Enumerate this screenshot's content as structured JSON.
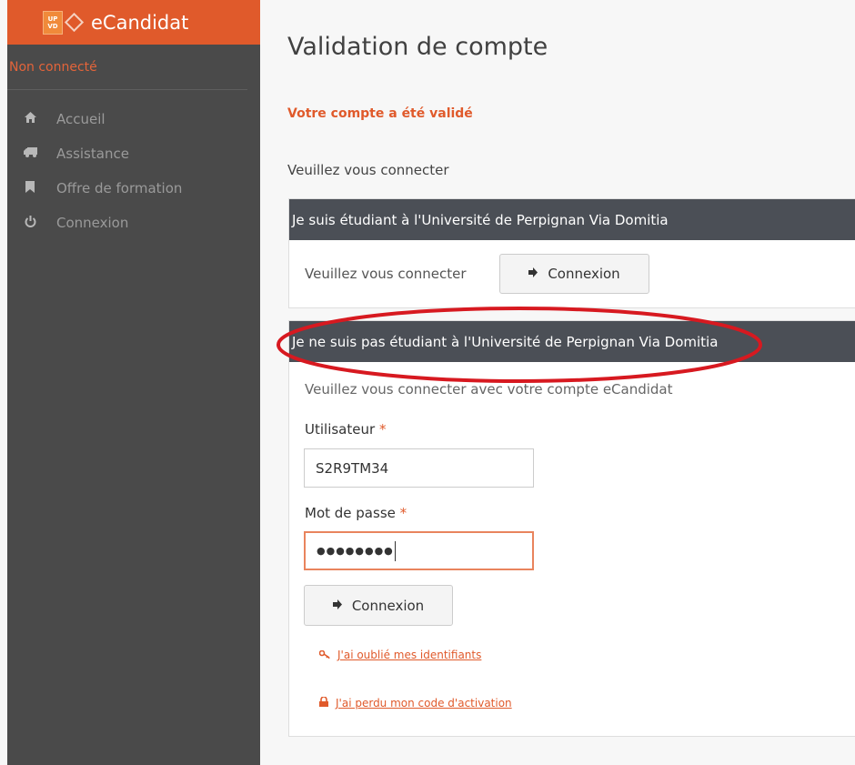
{
  "sidebar": {
    "brand": {
      "logo_line1": "UP",
      "logo_line2": "VD",
      "name": "eCandidat"
    },
    "status": "Non connecté",
    "items": [
      {
        "label": "Accueil",
        "icon": "home-icon"
      },
      {
        "label": "Assistance",
        "icon": "truck-icon"
      },
      {
        "label": "Offre de formation",
        "icon": "bookmark-icon"
      },
      {
        "label": "Connexion",
        "icon": "power-icon"
      }
    ]
  },
  "main": {
    "title": "Validation de compte",
    "success_message": "Votre compte a été validé",
    "intro": "Veuillez vous connecter",
    "panel_student": {
      "heading": "Je suis étudiant à l'Université de Perpignan Via Domitia",
      "text": "Veuillez vous connecter",
      "button_label": "Connexion",
      "button_icon": "sign-in-icon"
    },
    "panel_external": {
      "heading": "Je ne suis pas étudiant à l'Université de Perpignan Via Domitia",
      "lead": "Veuillez vous connecter avec votre compte eCandidat",
      "user_label": "Utilisateur",
      "user_value": "S2R9TM34",
      "password_label": "Mot de passe",
      "password_value": "●●●●●●●●",
      "required_mark": "*",
      "button_label": "Connexion",
      "button_icon": "sign-in-icon",
      "forgot_link": "J'ai oublié mes identifiants",
      "forgot_icon": "key-icon",
      "lost_code_link": "J'ai perdu mon code d'activation",
      "lost_code_icon": "lock-icon"
    }
  },
  "colors": {
    "accent": "#e05a2b",
    "sidebar_bg": "#4a4a4a",
    "panel_header_bg": "#4b4f56",
    "highlight_ellipse": "#d71920"
  }
}
